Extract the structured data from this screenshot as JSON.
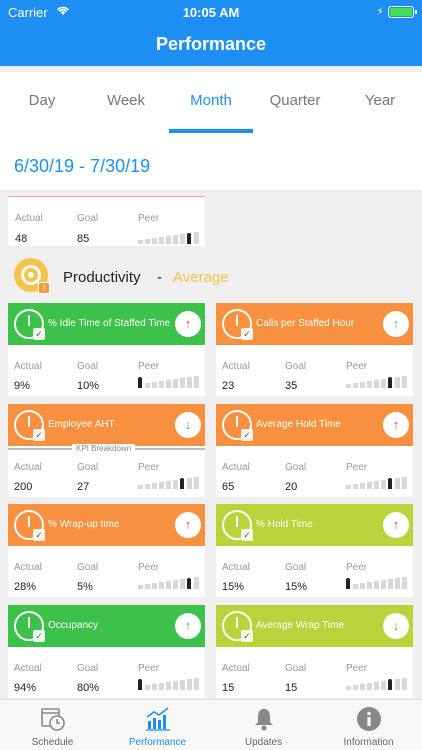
{
  "status_bar": {
    "carrier": "Carrier",
    "time": "10:05 AM"
  },
  "header": {
    "title": "Performance"
  },
  "tabs": [
    {
      "label": "Day"
    },
    {
      "label": "Week"
    },
    {
      "label": "Month",
      "active": true
    },
    {
      "label": "Quarter"
    },
    {
      "label": "Year"
    }
  ],
  "date_range": "6/30/19 - 7/30/19",
  "top_card": {
    "actual_label": "Actual",
    "goal_label": "Goal",
    "peer_label": "Peer",
    "actual": "48",
    "goal": "85"
  },
  "productivity": {
    "title": "Productivity",
    "separator": "-",
    "level": "Average"
  },
  "kpi_breakdown": "KPI Breakdown",
  "cards": [
    {
      "name": "% Idle Time of Staffed Time",
      "color": "#3cc24a",
      "arrow": "↑",
      "arrow_color": "#e23b5a",
      "actual": "9%",
      "goal": "10%",
      "actual_label": "Actual",
      "goal_label": "Goal",
      "peer_label": "Peer"
    },
    {
      "name": "Calls per Staffed Hour",
      "color": "#f7903f",
      "arrow": "↑",
      "arrow_color": "#3cc24a",
      "actual": "23",
      "goal": "35",
      "actual_label": "Actual",
      "goal_label": "Goal",
      "peer_label": "Peer"
    },
    {
      "name": "Employee AHT",
      "color": "#f7903f",
      "arrow": "↓",
      "arrow_color": "#3cc24a",
      "actual": "200",
      "goal": "27",
      "actual_label": "Actual",
      "goal_label": "Goal",
      "peer_label": "Peer"
    },
    {
      "name": "Average Hold Time",
      "color": "#f7903f",
      "arrow": "↑",
      "arrow_color": "#e23b5a",
      "actual": "65",
      "goal": "20",
      "actual_label": "Actual",
      "goal_label": "Goal",
      "peer_label": "Peer"
    },
    {
      "name": "% Wrap-up time",
      "color": "#f7903f",
      "arrow": "↑",
      "arrow_color": "#e23b5a",
      "actual": "28%",
      "goal": "5%",
      "actual_label": "Actual",
      "goal_label": "Goal",
      "peer_label": "Peer"
    },
    {
      "name": "% Hold Time",
      "color": "#b8d43a",
      "arrow": "↑",
      "arrow_color": "#e23b5a",
      "actual": "15%",
      "goal": "15%",
      "actual_label": "Actual",
      "goal_label": "Goal",
      "peer_label": "Peer"
    },
    {
      "name": "Occupancy",
      "color": "#3cc24a",
      "arrow": "↑",
      "arrow_color": "#3cc24a",
      "actual": "94%",
      "goal": "80%",
      "actual_label": "Actual",
      "goal_label": "Goal",
      "peer_label": "Peer"
    },
    {
      "name": "Average Wrap Time",
      "color": "#b8d43a",
      "arrow": "↓",
      "arrow_color": "#3cc24a",
      "actual": "15",
      "goal": "15",
      "actual_label": "Actual",
      "goal_label": "Goal",
      "peer_label": "Peer"
    }
  ],
  "bottom_nav": [
    {
      "label": "Schedule",
      "icon": "calendar-clock-icon"
    },
    {
      "label": "Performance",
      "icon": "bar-chart-icon",
      "active": true
    },
    {
      "label": "Updates",
      "icon": "bell-icon"
    },
    {
      "label": "Information",
      "icon": "info-icon"
    }
  ],
  "colors": {
    "brand": "#1e8ff2",
    "average": "#f6c34a"
  }
}
